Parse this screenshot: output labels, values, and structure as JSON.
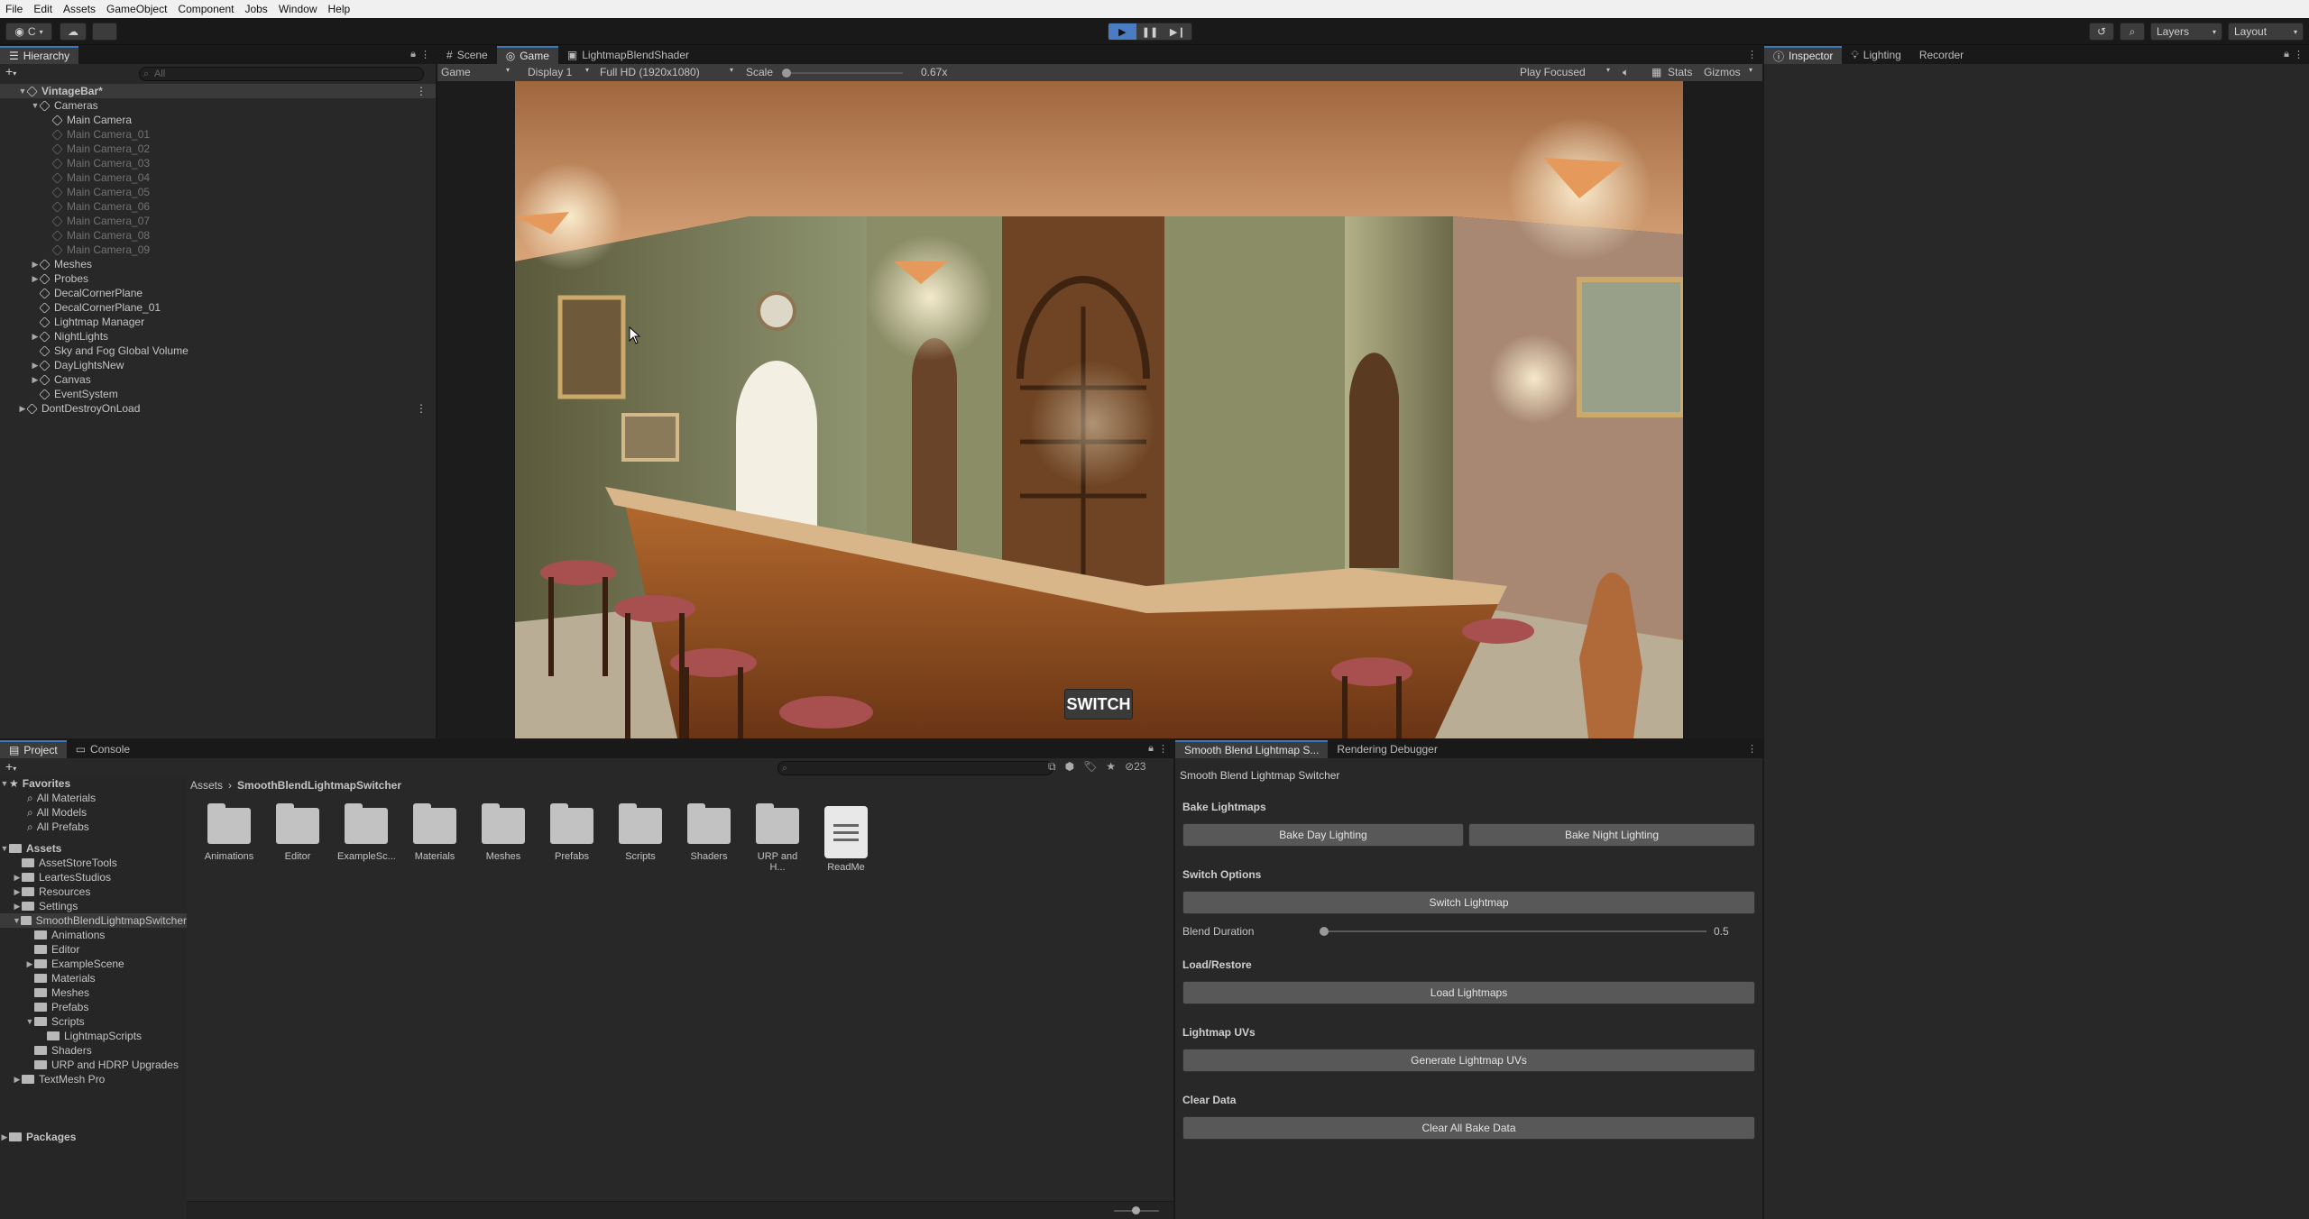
{
  "menu": [
    "File",
    "Edit",
    "Assets",
    "GameObject",
    "Component",
    "Jobs",
    "Window",
    "Help"
  ],
  "toolbar": {
    "account_label": "C",
    "play_icon": "play-icon",
    "pause_icon": "pause-icon",
    "step_icon": "step-icon",
    "layers_label": "Layers",
    "layout_label": "Layout"
  },
  "hierarchy": {
    "tab": "Hierarchy",
    "search_placeholder": "All",
    "rows": [
      {
        "label": "VintageBar*",
        "depth": 0,
        "arrow": "▼",
        "bold": true,
        "dim": false
      },
      {
        "label": "Cameras",
        "depth": 1,
        "arrow": "▼",
        "bold": false,
        "dim": false
      },
      {
        "label": "Main Camera",
        "depth": 2,
        "arrow": "",
        "bold": false,
        "dim": false
      },
      {
        "label": "Main Camera_01",
        "depth": 2,
        "arrow": "",
        "bold": false,
        "dim": true
      },
      {
        "label": "Main Camera_02",
        "depth": 2,
        "arrow": "",
        "bold": false,
        "dim": true
      },
      {
        "label": "Main Camera_03",
        "depth": 2,
        "arrow": "",
        "bold": false,
        "dim": true
      },
      {
        "label": "Main Camera_04",
        "depth": 2,
        "arrow": "",
        "bold": false,
        "dim": true
      },
      {
        "label": "Main Camera_05",
        "depth": 2,
        "arrow": "",
        "bold": false,
        "dim": true
      },
      {
        "label": "Main Camera_06",
        "depth": 2,
        "arrow": "",
        "bold": false,
        "dim": true
      },
      {
        "label": "Main Camera_07",
        "depth": 2,
        "arrow": "",
        "bold": false,
        "dim": true
      },
      {
        "label": "Main Camera_08",
        "depth": 2,
        "arrow": "",
        "bold": false,
        "dim": true
      },
      {
        "label": "Main Camera_09",
        "depth": 2,
        "arrow": "",
        "bold": false,
        "dim": true
      },
      {
        "label": "Meshes",
        "depth": 1,
        "arrow": "▶",
        "bold": false,
        "dim": false
      },
      {
        "label": "Probes",
        "depth": 1,
        "arrow": "▶",
        "bold": false,
        "dim": false
      },
      {
        "label": "DecalCornerPlane",
        "depth": 1,
        "arrow": "",
        "bold": false,
        "dim": false
      },
      {
        "label": "DecalCornerPlane_01",
        "depth": 1,
        "arrow": "",
        "bold": false,
        "dim": false
      },
      {
        "label": "Lightmap Manager",
        "depth": 1,
        "arrow": "",
        "bold": false,
        "dim": false
      },
      {
        "label": "NightLights",
        "depth": 1,
        "arrow": "▶",
        "bold": false,
        "dim": false
      },
      {
        "label": "Sky and Fog Global Volume",
        "depth": 1,
        "arrow": "",
        "bold": false,
        "dim": false
      },
      {
        "label": "DayLightsNew",
        "depth": 1,
        "arrow": "▶",
        "bold": false,
        "dim": false
      },
      {
        "label": "Canvas",
        "depth": 1,
        "arrow": "▶",
        "bold": false,
        "dim": false
      },
      {
        "label": "EventSystem",
        "depth": 1,
        "arrow": "",
        "bold": false,
        "dim": false
      },
      {
        "label": "DontDestroyOnLoad",
        "depth": 0,
        "arrow": "▶",
        "bold": false,
        "dim": false
      }
    ]
  },
  "game": {
    "tabs": [
      "Scene",
      "Game",
      "LightmapBlendShader"
    ],
    "view_mode": "Game",
    "display": "Display 1",
    "resolution": "Full HD (1920x1080)",
    "scale_label": "Scale",
    "scale_value": "0.67x",
    "play_mode": "Play Focused",
    "stats": "Stats",
    "gizmos": "Gizmos",
    "switch_button": "SWITCH"
  },
  "inspector": {
    "tabs": [
      "Inspector",
      "Lighting",
      "Recorder"
    ]
  },
  "project": {
    "tabs": [
      "Project",
      "Console"
    ],
    "hidden_count": "23",
    "favorites_label": "Favorites",
    "favorites": [
      "All Materials",
      "All Models",
      "All Prefabs"
    ],
    "assets_label": "Assets",
    "tree": [
      {
        "label": "AssetStoreTools",
        "depth": 1,
        "arrow": ""
      },
      {
        "label": "LeartesStudios",
        "depth": 1,
        "arrow": "▶"
      },
      {
        "label": "Resources",
        "depth": 1,
        "arrow": "▶"
      },
      {
        "label": "Settings",
        "depth": 1,
        "arrow": "▶"
      },
      {
        "label": "SmoothBlendLightmapSwitcher",
        "depth": 1,
        "arrow": "▼",
        "selected": true
      },
      {
        "label": "Animations",
        "depth": 2,
        "arrow": ""
      },
      {
        "label": "Editor",
        "depth": 2,
        "arrow": ""
      },
      {
        "label": "ExampleScene",
        "depth": 2,
        "arrow": "▶"
      },
      {
        "label": "Materials",
        "depth": 2,
        "arrow": ""
      },
      {
        "label": "Meshes",
        "depth": 2,
        "arrow": ""
      },
      {
        "label": "Prefabs",
        "depth": 2,
        "arrow": ""
      },
      {
        "label": "Scripts",
        "depth": 2,
        "arrow": "▼"
      },
      {
        "label": "LightmapScripts",
        "depth": 3,
        "arrow": ""
      },
      {
        "label": "Shaders",
        "depth": 2,
        "arrow": ""
      },
      {
        "label": "URP and HDRP Upgrades",
        "depth": 2,
        "arrow": ""
      },
      {
        "label": "TextMesh Pro",
        "depth": 1,
        "arrow": "▶"
      }
    ],
    "packages_label": "Packages",
    "breadcrumb_root": "Assets",
    "breadcrumb_current": "SmoothBlendLightmapSwitcher",
    "grid": [
      "Animations",
      "Editor",
      "ExampleSc...",
      "Materials",
      "Meshes",
      "Prefabs",
      "Scripts",
      "Shaders",
      "URP and H...",
      "ReadMe"
    ]
  },
  "switcher": {
    "tabs": [
      "Smooth Blend Lightmap S...",
      "Rendering Debugger"
    ],
    "title": "Smooth Blend Lightmap Switcher",
    "bake_header": "Bake Lightmaps",
    "bake_day": "Bake Day Lighting",
    "bake_night": "Bake Night Lighting",
    "switch_header": "Switch Options",
    "switch_button": "Switch Lightmap",
    "blend_label": "Blend Duration",
    "blend_value": "0.5",
    "blend_fraction": 0.0,
    "load_header": "Load/Restore",
    "load_button": "Load Lightmaps",
    "uv_header": "Lightmap UVs",
    "uv_button": "Generate Lightmap UVs",
    "clear_header": "Clear Data",
    "clear_button": "Clear All Bake Data"
  }
}
